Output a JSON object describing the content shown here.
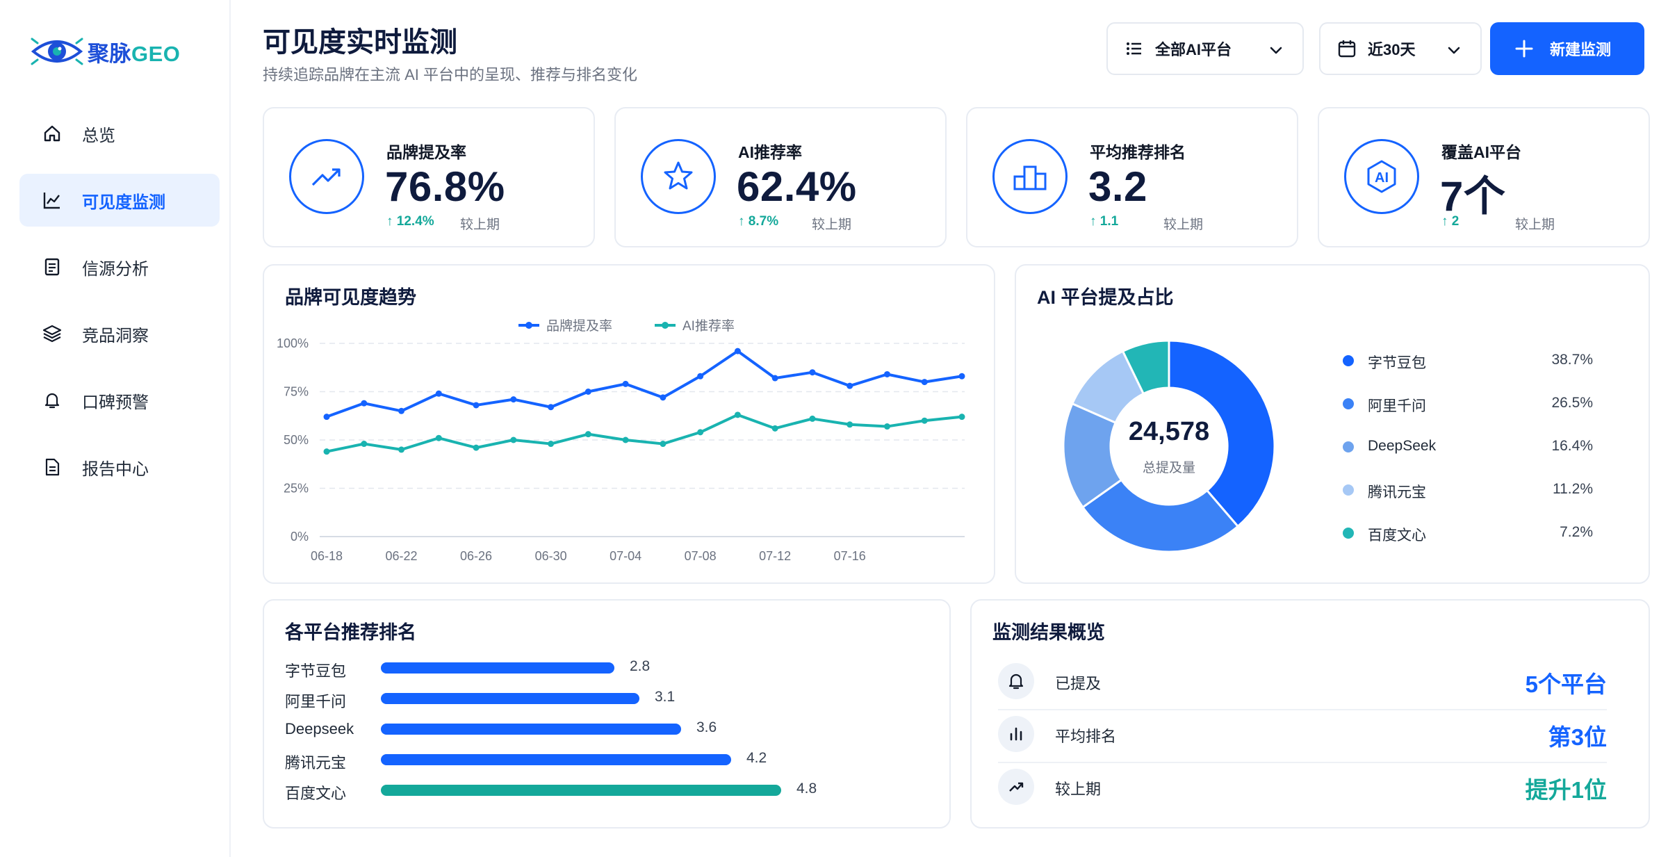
{
  "brand": {
    "name_cn": "聚脉",
    "name_en": "GEO"
  },
  "sidebar": {
    "items": [
      {
        "label": "总览",
        "icon": "home-icon",
        "active": false
      },
      {
        "label": "可见度监测",
        "icon": "chart-line-icon",
        "active": true
      },
      {
        "label": "信源分析",
        "icon": "document-list-icon",
        "active": false
      },
      {
        "label": "竞品洞察",
        "icon": "layers-icon",
        "active": false
      },
      {
        "label": "口碑预警",
        "icon": "bell-icon",
        "active": false
      },
      {
        "label": "报告中心",
        "icon": "report-icon",
        "active": false
      }
    ]
  },
  "header": {
    "title": "可见度实时监测",
    "subtitle": "持续追踪品牌在主流 AI 平台中的呈现、推荐与排名变化",
    "platform_filter": "全部AI平台",
    "date_filter": "近30天",
    "new_button": "新建监测"
  },
  "kpis": [
    {
      "label": "品牌提及率",
      "value": "76.8%",
      "delta": "↑ 12.4%",
      "compare": "较上期",
      "icon": "trend-up-icon"
    },
    {
      "label": "AI推荐率",
      "value": "62.4%",
      "delta": "↑ 8.7%",
      "compare": "较上期",
      "icon": "star-icon"
    },
    {
      "label": "平均推荐排名",
      "value": "3.2",
      "delta": "↑ 1.1",
      "compare": "较上期",
      "icon": "podium-icon"
    },
    {
      "label": "覆盖AI平台",
      "value": "7个",
      "delta": "↑ 2",
      "compare": "较上期",
      "icon": "ai-icon"
    }
  ],
  "trend_card": {
    "title": "品牌可见度趋势"
  },
  "share_card": {
    "title": "AI 平台提及占比",
    "center_value": "24,578",
    "center_label": "总提及量"
  },
  "rank_card": {
    "title": "各平台推荐排名"
  },
  "results_card": {
    "title": "监测结果概览",
    "rows": [
      {
        "label": "已提及",
        "value": "5个平台",
        "icon": "bell-icon",
        "color": "#1463ff"
      },
      {
        "label": "平均排名",
        "value": "第3位",
        "icon": "bar-chart-icon",
        "color": "#1463ff"
      },
      {
        "label": "较上期",
        "value": "提升1位",
        "icon": "trend-up-icon",
        "color": "#14a89a"
      }
    ]
  },
  "colors": {
    "primary": "#1463ff",
    "teal": "#19b3b0",
    "positive": "#14a89a"
  },
  "chart_data": [
    {
      "type": "line",
      "title": "品牌可见度趋势",
      "x": [
        "06-18",
        "06-20",
        "06-22",
        "06-24",
        "06-26",
        "06-28",
        "06-30",
        "07-02",
        "07-04",
        "07-06",
        "07-08",
        "07-10",
        "07-12",
        "07-14",
        "07-16",
        "07-18",
        "07-20",
        "07-22"
      ],
      "x_tick_labels": [
        "06-18",
        "06-22",
        "06-26",
        "06-30",
        "07-04",
        "07-08",
        "07-12",
        "07-16"
      ],
      "ylim": [
        0,
        100
      ],
      "y_ticks": [
        "0%",
        "25%",
        "50%",
        "75%",
        "100%"
      ],
      "legend_position": "top-center",
      "grid": true,
      "series": [
        {
          "name": "品牌提及率",
          "color": "#1463ff",
          "values": [
            62,
            69,
            65,
            74,
            68,
            71,
            67,
            75,
            79,
            72,
            83,
            96,
            82,
            85,
            78,
            84,
            80,
            83
          ]
        },
        {
          "name": "AI推荐率",
          "color": "#19b3b0",
          "values": [
            44,
            48,
            45,
            51,
            46,
            50,
            48,
            53,
            50,
            48,
            54,
            63,
            56,
            61,
            58,
            57,
            60,
            62
          ]
        }
      ]
    },
    {
      "type": "pie",
      "title": "AI 平台提及占比",
      "categories": [
        "字节豆包",
        "阿里千问",
        "DeepSeek",
        "腾讯元宝",
        "百度文心"
      ],
      "values": [
        38.7,
        26.5,
        16.4,
        11.2,
        7.2
      ],
      "labels": [
        "38.7%",
        "26.5%",
        "16.4%",
        "11.2%",
        "7.2%"
      ],
      "colors": [
        "#1463ff",
        "#3b82f6",
        "#6ea3ee",
        "#a6c8f5",
        "#22b6b6"
      ]
    },
    {
      "type": "bar",
      "title": "各平台推荐排名",
      "orientation": "horizontal",
      "categories": [
        "字节豆包",
        "阿里千问",
        "Deepseek",
        "腾讯元宝",
        "百度文心"
      ],
      "values": [
        2.8,
        3.1,
        3.6,
        4.2,
        4.8
      ],
      "labels": [
        "2.8",
        "3.1",
        "3.6",
        "4.2",
        "4.8"
      ],
      "colors": [
        "#1463ff",
        "#1463ff",
        "#1463ff",
        "#1463ff",
        "#14a89a"
      ],
      "xlim": [
        0,
        6
      ]
    }
  ]
}
